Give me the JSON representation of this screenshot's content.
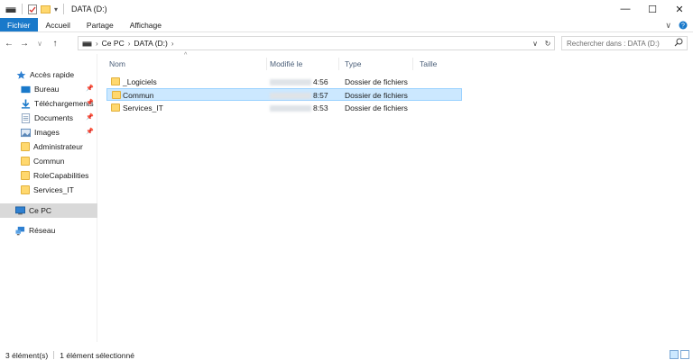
{
  "window": {
    "title": "DATA (D:)",
    "controls": {
      "minimize": "—",
      "maximize": "☐",
      "close": "✕"
    }
  },
  "ribbon": {
    "tabs": [
      {
        "label": "Fichier"
      },
      {
        "label": "Accueil"
      },
      {
        "label": "Partage"
      },
      {
        "label": "Affichage"
      }
    ],
    "expand_icon": "chevron-down-icon",
    "help_icon": "help-icon"
  },
  "nav": {
    "back": "←",
    "forward": "→",
    "recent": "∨",
    "up": "↑",
    "breadcrumb": [
      "Ce PC",
      "DATA (D:)"
    ],
    "dropdown": "∨",
    "refresh": "↻"
  },
  "search": {
    "placeholder": "Rechercher dans : DATA (D:)"
  },
  "sidebar": {
    "quick_access": "Accès rapide",
    "items": [
      {
        "label": "Bureau",
        "icon": "desktop-icon",
        "pinned": true
      },
      {
        "label": "Téléchargements",
        "icon": "download-icon",
        "pinned": true
      },
      {
        "label": "Documents",
        "icon": "documents-icon",
        "pinned": true
      },
      {
        "label": "Images",
        "icon": "images-icon",
        "pinned": true
      },
      {
        "label": "Administrateur",
        "icon": "folder-icon",
        "pinned": false
      },
      {
        "label": "Commun",
        "icon": "folder-icon",
        "pinned": false
      },
      {
        "label": "RoleCapabilities",
        "icon": "folder-icon",
        "pinned": false
      },
      {
        "label": "Services_IT",
        "icon": "folder-icon",
        "pinned": false
      }
    ],
    "this_pc": "Ce PC",
    "network": "Réseau"
  },
  "columns": {
    "name": "Nom",
    "modified": "Modifié le",
    "type": "Type",
    "size": "Taille"
  },
  "files": [
    {
      "name": "_Logiciels",
      "time": "4:56",
      "type": "Dossier de fichiers",
      "selected": false
    },
    {
      "name": "Commun",
      "time": "8:57",
      "type": "Dossier de fichiers",
      "selected": true
    },
    {
      "name": "Services_IT",
      "time": "8:53",
      "type": "Dossier de fichiers",
      "selected": false
    }
  ],
  "status": {
    "count": "3 élément(s)",
    "selection": "1 élément sélectionné"
  },
  "colors": {
    "accent": "#1979ca",
    "selection_bg": "#cce8ff",
    "selection_border": "#99d1ff",
    "folder": "#ffd86e"
  }
}
